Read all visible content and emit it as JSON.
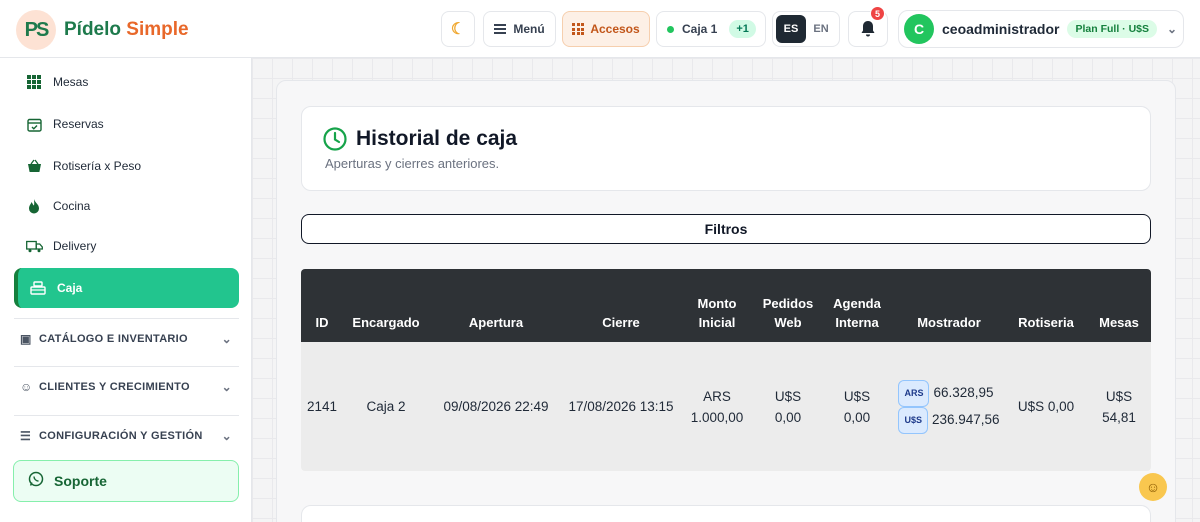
{
  "app": {
    "logo_mark": "PS",
    "name_a": "Pídelo",
    "name_b": "Simple"
  },
  "topbar": {
    "menu_label": "Menú",
    "accesos_label": "Accesos",
    "caja_label": "Caja 1",
    "caja_badge": "+1",
    "lang_es": "ES",
    "lang_en": "EN",
    "notif_count": "5",
    "user_initial": "C",
    "username": "ceoadministrador",
    "plan": "Plan Full · U$S"
  },
  "sidebar": {
    "items": [
      {
        "label": "Mesas",
        "icon": "grid-icon"
      },
      {
        "label": "Reservas",
        "icon": "calendar-check-icon"
      },
      {
        "label": "Rotisería x Peso",
        "icon": "basket-icon"
      },
      {
        "label": "Cocina",
        "icon": "flame-icon"
      },
      {
        "label": "Delivery",
        "icon": "truck-icon"
      },
      {
        "label": "Caja",
        "icon": "cash-register-icon",
        "active": true
      }
    ],
    "sections": [
      {
        "label": "CATÁLOGO E INVENTARIO",
        "icon": "box-icon"
      },
      {
        "label": "CLIENTES Y CRECIMIENTO",
        "icon": "users-icon"
      },
      {
        "label": "CONFIGURACIÓN Y GESTIÓN",
        "icon": "sliders-icon"
      }
    ],
    "support_label": "Soporte"
  },
  "page": {
    "title": "Historial de caja",
    "subtitle": "Aperturas y cierres anteriores.",
    "filters_label": "Filtros"
  },
  "table": {
    "headers": [
      "ID",
      "Encargado",
      "Apertura",
      "Cierre",
      "Monto Inicial",
      "Pedidos Web",
      "Agenda Interna",
      "Mostrador",
      "Rotiseria",
      "Mesas"
    ],
    "row": {
      "id": "2141",
      "encargado": "Caja 2",
      "apertura": "09/08/2026 22:49",
      "cierre": "17/08/2026 13:15",
      "monto_inicial": "ARS 1.000,00",
      "pedidos_web": "U$S 0,00",
      "agenda_interna": "U$S 0,00",
      "mostrador_ars_badge": "ARS",
      "mostrador_ars": "66.328,95",
      "mostrador_usd_badge": "U$S",
      "mostrador_usd": "236.947,56",
      "rotiseria": "U$S 0,00",
      "mesas": "U$S 54,81"
    }
  },
  "colors": {
    "brand_green": "#1e7a4c",
    "brand_orange": "#e8682a",
    "active_green": "#22c58e",
    "table_header": "#2e3236"
  }
}
